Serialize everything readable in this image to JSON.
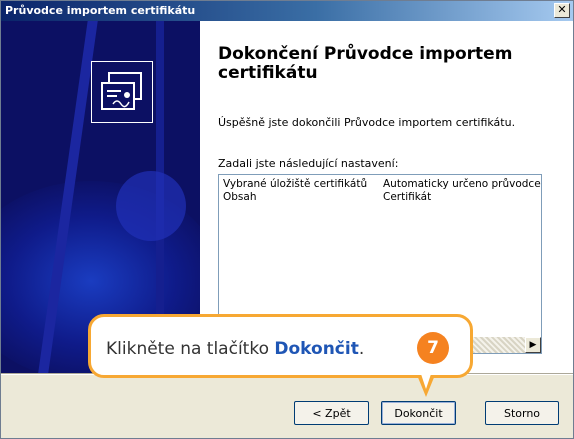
{
  "window": {
    "title": "Průvodce importem certifikátu",
    "close_glyph": "✕"
  },
  "banner": {
    "icon": "certificate-icon"
  },
  "main": {
    "heading": "Dokončení Průvodce importem certifikátu",
    "success_text": "Úspěšně jste dokončili Průvodce importem certifikátu.",
    "settings_label": "Zadali jste následující nastavení:",
    "settings": [
      {
        "key": "Vybrané úložiště certifikátů",
        "value": "Automaticky určeno průvodcem"
      },
      {
        "key": "Obsah",
        "value": "Certifikát"
      }
    ]
  },
  "buttons": {
    "back": "< Zpět",
    "finish": "Dokončit",
    "cancel": "Storno"
  },
  "callout": {
    "text_before": "Klikněte na tlačítko ",
    "keyword": "Dokončit",
    "text_after": ".",
    "step": "7",
    "border_color": "#f7a833",
    "badge_color": "#f58220"
  }
}
